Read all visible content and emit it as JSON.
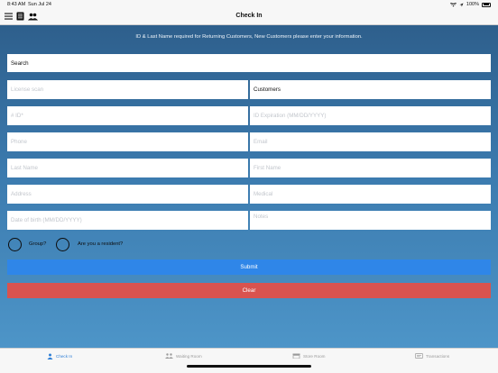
{
  "status": {
    "time": "8:43 AM",
    "date": "Sun Jul 24",
    "battery": "100%"
  },
  "nav": {
    "title": "Check In"
  },
  "notice": "ID & Last Name required for Returning Customers, New Customers please enter your information.",
  "form": {
    "search": "Search",
    "license_scan": "License scan",
    "customer_type": "Customers",
    "id_number": "# ID*",
    "id_expiration": "ID Expiration (MM/DD/YYYY)",
    "phone": "Phone",
    "email": "Email",
    "last_name": "Last Name",
    "first_name": "First Name",
    "address": "Address",
    "medical": "Medical",
    "dob": "Date of birth (MM/DD/YYYY)",
    "notes": "Notes",
    "group_label": "Group?",
    "resident_label": "Are you a resident?"
  },
  "buttons": {
    "submit": "Submit",
    "clear": "Clear"
  },
  "tabs": [
    {
      "label": "Check In",
      "icon": "person-icon",
      "active": true
    },
    {
      "label": "Waiting Room",
      "icon": "people-icon",
      "active": false
    },
    {
      "label": "Store Room",
      "icon": "store-icon",
      "active": false
    },
    {
      "label": "Transactions",
      "icon": "receipt-icon",
      "active": false
    }
  ],
  "colors": {
    "accent": "#2f86e8",
    "danger": "#d9534f",
    "active_tab": "#2f7fd6"
  }
}
